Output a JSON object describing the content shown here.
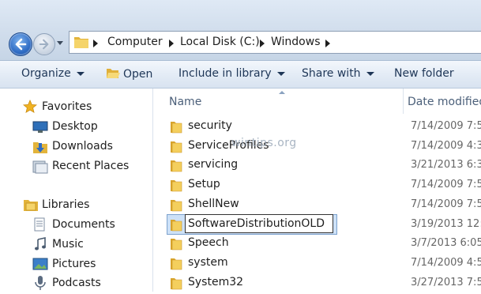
{
  "address": {
    "crumbs": [
      "Computer",
      "Local Disk (C:)",
      "Windows"
    ]
  },
  "toolbar": {
    "organize": "Organize",
    "open": "Open",
    "include_in_library": "Include in library",
    "share_with": "Share with",
    "new_folder": "New folder"
  },
  "navigation": {
    "favorites": {
      "header": "Favorites",
      "items": [
        "Desktop",
        "Downloads",
        "Recent Places"
      ]
    },
    "libraries": {
      "header": "Libraries",
      "items": [
        "Documents",
        "Music",
        "Pictures",
        "Podcasts"
      ]
    }
  },
  "columns": {
    "name": "Name",
    "date_modified": "Date modified"
  },
  "files": [
    {
      "name": "security",
      "date": "7/14/2009 7:5"
    },
    {
      "name": "ServiceProfiles",
      "date": "7/14/2009 4:3"
    },
    {
      "name": "servicing",
      "date": "3/21/2013 6:3"
    },
    {
      "name": "Setup",
      "date": "7/14/2009 7:5"
    },
    {
      "name": "ShellNew",
      "date": "7/14/2009 7:5"
    },
    {
      "name": "SoftwareDistributionOLD",
      "date": "3/19/2013 12:"
    },
    {
      "name": "Speech",
      "date": "3/7/2013 6:05"
    },
    {
      "name": "system",
      "date": "7/14/2009 4:5"
    },
    {
      "name": "System32",
      "date": "3/27/2013 7:5"
    }
  ],
  "watermark": "wintips.org",
  "colors": {
    "accent": "#2f6cc4",
    "folder": "#f2c84b",
    "selection": "#cde1f7"
  }
}
